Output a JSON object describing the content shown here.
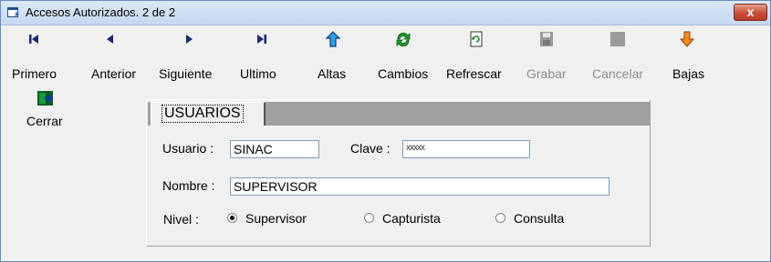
{
  "window": {
    "title": "Accesos Autorizados. 2 de 2",
    "close_label": "x"
  },
  "toolbar": {
    "primero": "Primero",
    "anterior": "Anterior",
    "siguiente": "Siguiente",
    "ultimo": "Ultimo",
    "altas": "Altas",
    "cambios": "Cambios",
    "refrescar": "Refrescar",
    "grabar": "Grabar",
    "cancelar": "Cancelar",
    "bajas": "Bajas",
    "cerrar": "Cerrar"
  },
  "form": {
    "tab_label": "USUARIOS",
    "usuario_label": "Usuario :",
    "usuario_value": "SINAC",
    "clave_label": "Clave :",
    "clave_value": "xxxxx",
    "nombre_label": "Nombre :",
    "nombre_value": "SUPERVISOR",
    "nivel_label": "Nivel :",
    "nivel_options": [
      "Supervisor",
      "Capturista",
      "Consulta"
    ],
    "nivel_selected": "Supervisor"
  }
}
